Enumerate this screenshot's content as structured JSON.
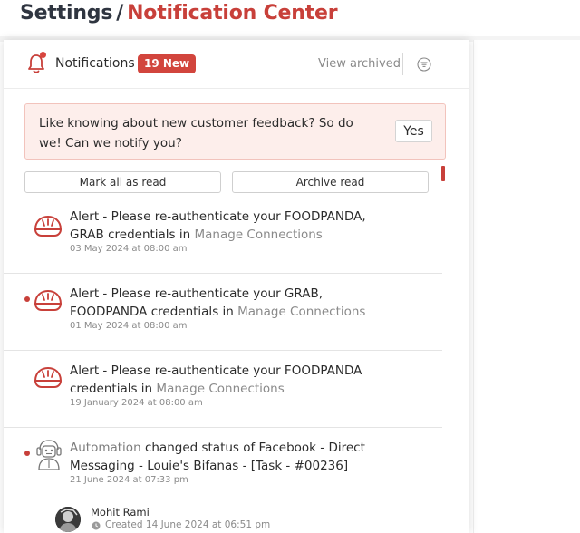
{
  "breadcrumb": {
    "root": "Settings",
    "separator": "/",
    "current": "Notification Center"
  },
  "panel": {
    "title": "Notifications",
    "new_badge": "19 New",
    "view_archived": "View archived",
    "bell_icon": "bell-icon",
    "filter_icon": "filter-icon"
  },
  "banner": {
    "text": "Like knowing about new customer feedback? So do we! Can we notify you?",
    "yes_label": "Yes"
  },
  "actions": {
    "mark_all_read": "Mark all as read",
    "archive_read": "Archive read"
  },
  "notifications": [
    {
      "text": "Alert - Please re-authenticate your FOODPANDA, GRAB credentials in",
      "link": "Manage Connections",
      "date": "03 May 2024 at 08:00 am",
      "icon": "bowl-icon",
      "unread": false
    },
    {
      "text": "Alert - Please re-authenticate your GRAB, FOODPANDA credentials in",
      "link": "Manage Connections",
      "date": "01 May 2024 at 08:00 am",
      "icon": "bowl-icon",
      "unread": true
    },
    {
      "text": "Alert - Please re-authenticate your FOODPANDA credentials in",
      "link": "Manage Connections",
      "date": "19 January 2024 at 08:00 am",
      "icon": "bowl-icon",
      "unread": false
    },
    {
      "actor": "Automation",
      "text": "changed status of Facebook - Direct Messaging - Louie's Bifanas - [Task - #00236]",
      "date": "21 June 2024 at 07:33 pm",
      "icon": "robot-icon",
      "unread": true
    }
  ],
  "comment": {
    "author": "Mohit Rami",
    "created": "Created 14 June 2024 at 06:51 pm",
    "clock_icon": "clock-icon"
  },
  "colors": {
    "accent": "#c8403a",
    "badge": "#d2453d",
    "banner_bg": "#fdeeeb",
    "link_gray": "#8a8a8a"
  }
}
